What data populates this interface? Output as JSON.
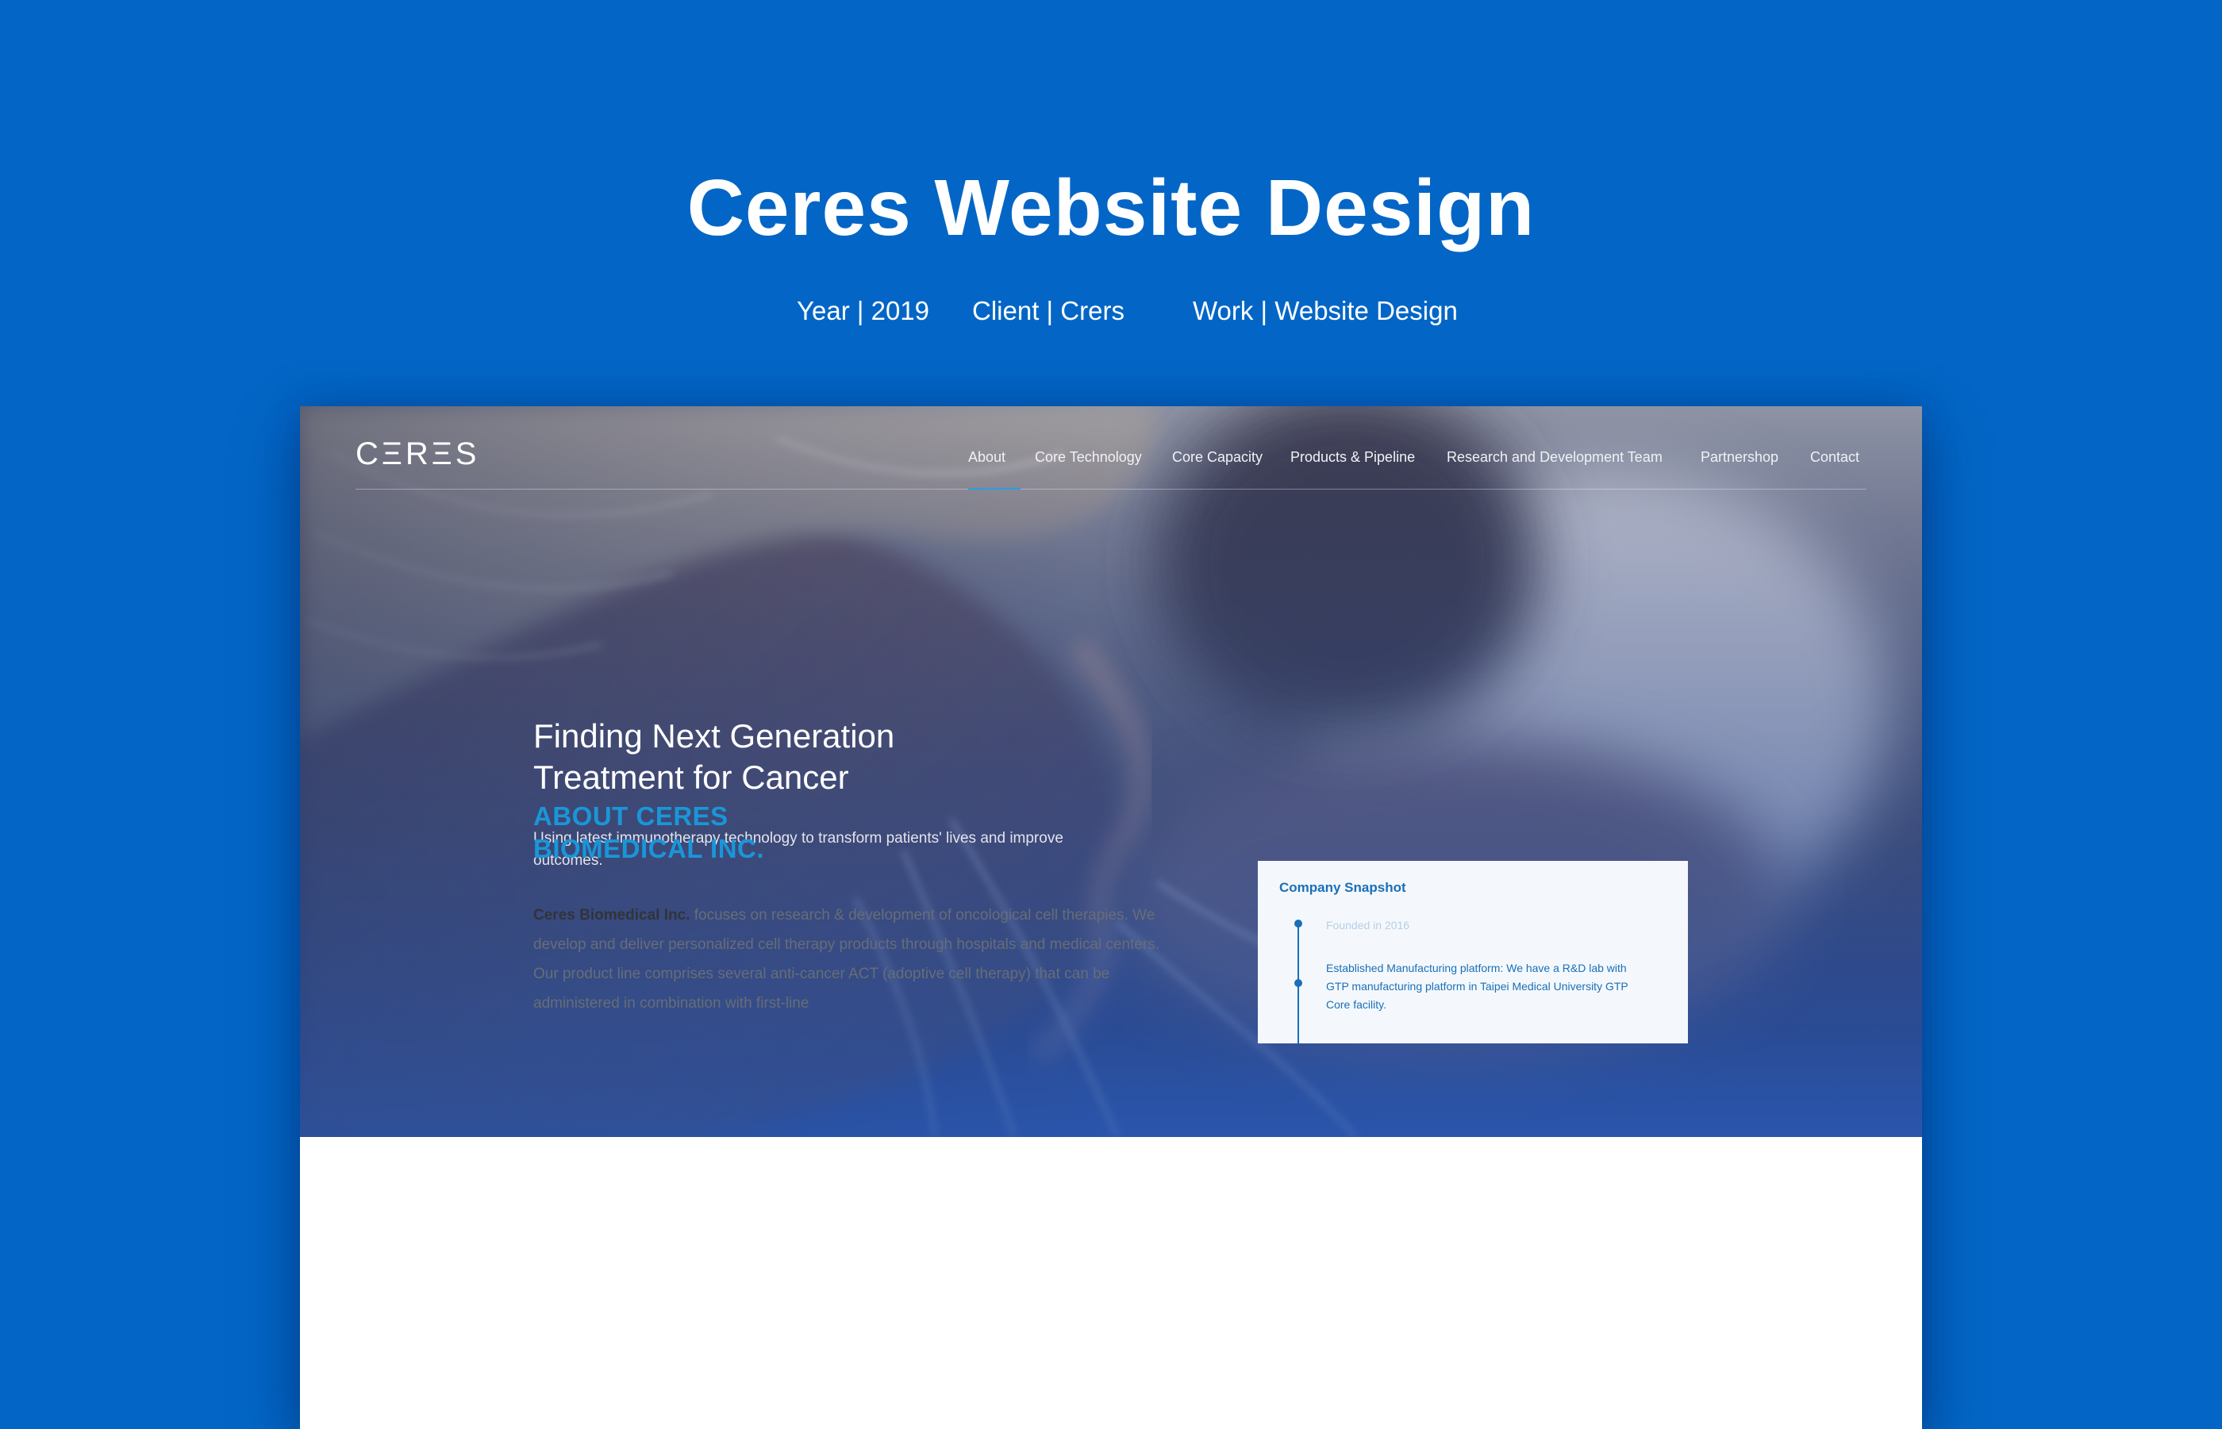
{
  "showcase": {
    "title": "Ceres Website Design",
    "year": "Year | 2019",
    "client": "Client | Crers",
    "work": "Work | Website Design",
    "background_color": "#0366c6"
  },
  "site": {
    "logo": "CΞRΞS",
    "nav": [
      {
        "label": "About",
        "active": true
      },
      {
        "label": "Core Technology"
      },
      {
        "label": "Core Capacity"
      },
      {
        "label": "Products & Pipeline"
      },
      {
        "label": "Research and Development Team"
      },
      {
        "label": "Partnershop"
      },
      {
        "label": "Contact"
      }
    ],
    "hero": {
      "heading_line1": "Finding Next Generation",
      "heading_line2": "Treatment for Cancer",
      "subtitle": "Using latest immunotherapy technology to transform patients' lives and improve outcomes."
    },
    "about": {
      "heading_line1": "ABOUT CERES",
      "heading_line2": "BIOMEDICAL INC.",
      "company_name": "Ceres Biomedical Inc.",
      "body": " focuses on research & development of oncological cell therapies. We develop and deliver personalized cell therapy products through hospitals and medical centers. Our product line comprises several anti-cancer ACT (adoptive cell therapy) that can be administered in combination with first-line"
    },
    "snapshot": {
      "title": "Company Snapshot",
      "founded": "Founded in 2016",
      "manufacturing": "Established Manufacturing platform: We have a R&D lab with GTP manufacturing platform in Taipei Medical University GTP Core facility."
    },
    "accent_color": "#1a96d8"
  }
}
